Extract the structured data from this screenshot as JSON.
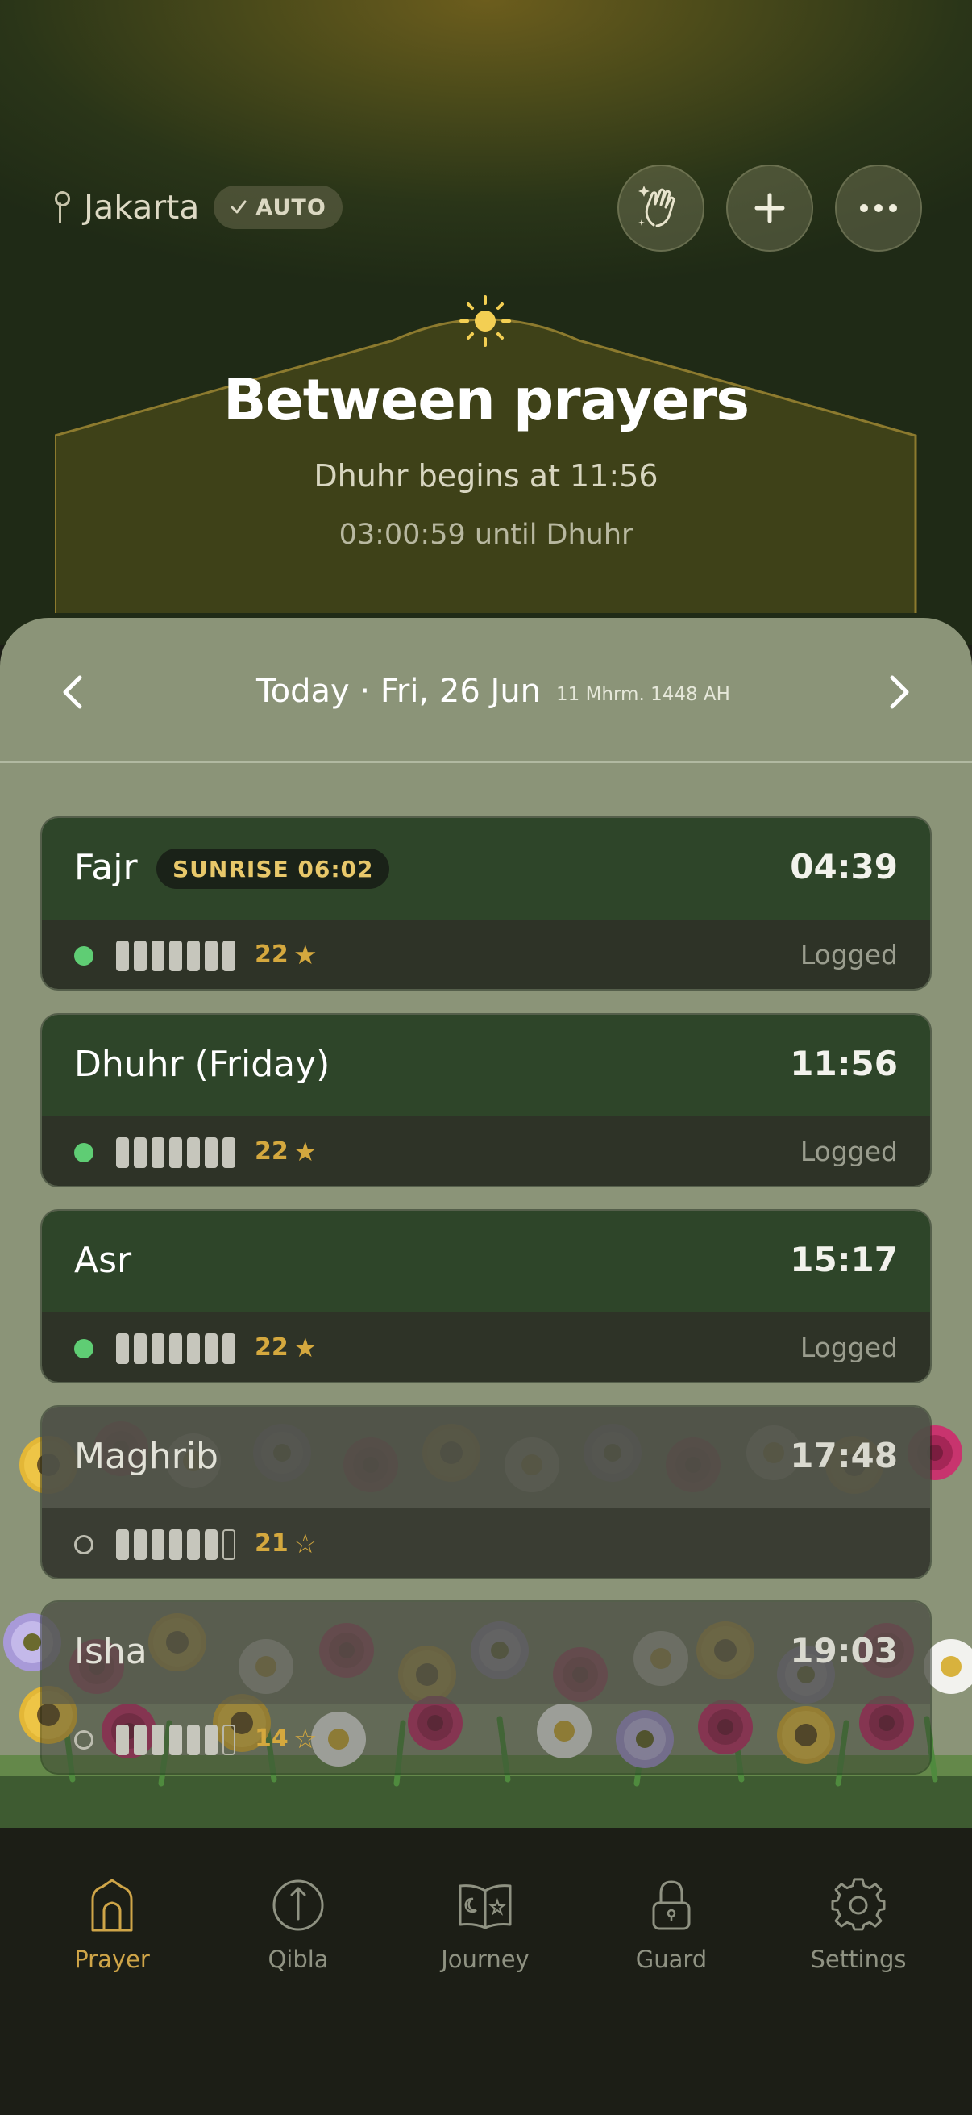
{
  "header": {
    "location": "Jakarta",
    "location_mode": "AUTO",
    "actions": [
      "hands-icon",
      "plus-icon",
      "more-icon"
    ]
  },
  "status": {
    "title": "Between prayers",
    "next_prayer_line": "Dhuhr begins at 11:56",
    "countdown_line": "03:00:59 until Dhuhr"
  },
  "date_nav": {
    "date": "Today · Fri, 26 Jun",
    "hijri": "11 Mhrm. 1448 AH"
  },
  "prayers": [
    {
      "name": "Fajr",
      "badge": "SUNRISE 06:02",
      "time": "04:39",
      "filled": 7,
      "total": 7,
      "score": "22",
      "star": "★",
      "status": "Logged",
      "logged": true
    },
    {
      "name": "Dhuhr (Friday)",
      "time": "11:56",
      "filled": 7,
      "total": 7,
      "score": "22",
      "star": "★",
      "status": "Logged",
      "logged": true
    },
    {
      "name": "Asr",
      "time": "15:17",
      "filled": 7,
      "total": 7,
      "score": "22",
      "star": "★",
      "status": "Logged",
      "logged": true
    },
    {
      "name": "Maghrib",
      "time": "17:48",
      "filled": 6,
      "total": 7,
      "score": "21",
      "star": "☆",
      "status": "",
      "logged": false
    },
    {
      "name": "Isha",
      "time": "19:03",
      "filled": 6,
      "total": 7,
      "score": "14",
      "star": "☆",
      "status": "",
      "logged": false
    }
  ],
  "tabs": [
    {
      "label": "Prayer",
      "icon": "mosque-icon",
      "active": true
    },
    {
      "label": "Qibla",
      "icon": "compass-icon",
      "active": false
    },
    {
      "label": "Journey",
      "icon": "book-icon",
      "active": false
    },
    {
      "label": "Guard",
      "icon": "lock-icon",
      "active": false
    },
    {
      "label": "Settings",
      "icon": "gear-icon",
      "active": false
    }
  ],
  "colors": {
    "accent": "#cfa548",
    "logged_dot": "#5fcd74",
    "card_done": "#2e4529",
    "sheet": "#8b9478"
  }
}
